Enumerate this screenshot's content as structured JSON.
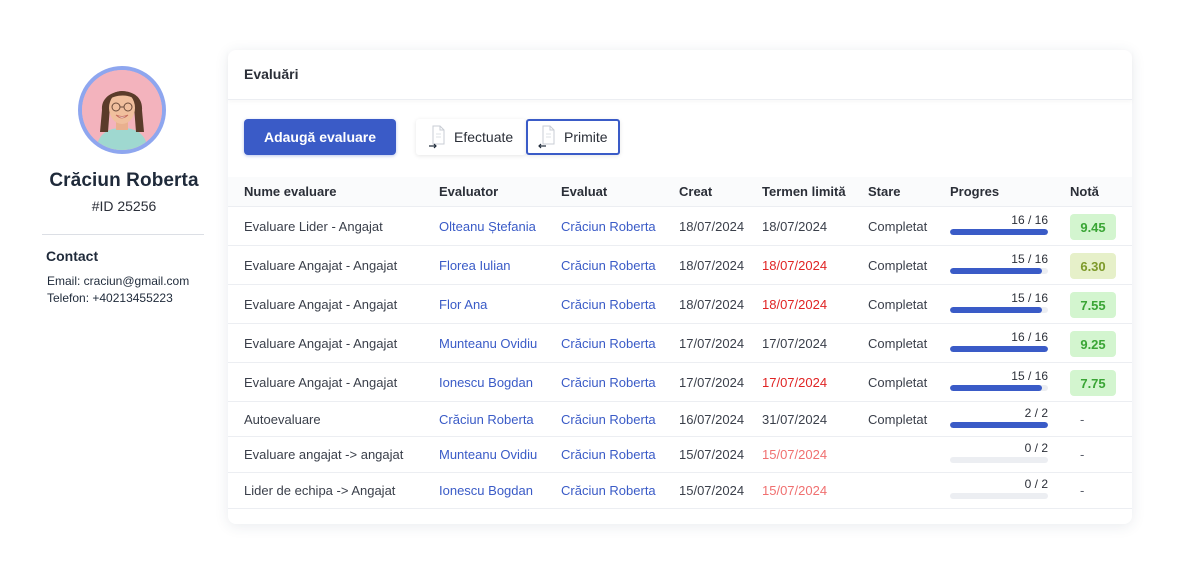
{
  "profile": {
    "name": "Crăciun Roberta",
    "id": "#ID 25256",
    "contact_title": "Contact",
    "email_line": "Email: craciun@gmail.com",
    "phone_line": "Telefon: +40213455223"
  },
  "card": {
    "title": "Evaluări",
    "add_button": "Adaugă evaluare",
    "tab_done": "Efectuate",
    "tab_received": "Primite",
    "active_tab": "Primite"
  },
  "table": {
    "headers": [
      "Nume evaluare",
      "Evaluator",
      "Evaluat",
      "Creat",
      "Termen limită",
      "Stare",
      "Progres",
      "Notă"
    ],
    "rows": [
      {
        "name": "Evaluare Lider - Angajat",
        "evaluator": "Olteanu Ștefania",
        "evaluated": "Crăciun Roberta",
        "created": "18/07/2024",
        "deadline": "18/07/2024",
        "deadline_status": "normal",
        "status": "Completat",
        "progress": "16 / 16",
        "progress_fraction": 1.0,
        "grade": "9.45",
        "grade_style": "green"
      },
      {
        "name": "Evaluare Angajat - Angajat",
        "evaluator": "Florea Iulian",
        "evaluated": "Crăciun Roberta",
        "created": "18/07/2024",
        "deadline": "18/07/2024",
        "deadline_status": "overdue",
        "status": "Completat",
        "progress": "15 / 16",
        "progress_fraction": 0.9375,
        "grade": "6.30",
        "grade_style": "olive"
      },
      {
        "name": "Evaluare Angajat - Angajat",
        "evaluator": "Flor Ana",
        "evaluated": "Crăciun Roberta",
        "created": "18/07/2024",
        "deadline": "18/07/2024",
        "deadline_status": "overdue",
        "status": "Completat",
        "progress": "15 / 16",
        "progress_fraction": 0.9375,
        "grade": "7.55",
        "grade_style": "green"
      },
      {
        "name": "Evaluare Angajat - Angajat",
        "evaluator": "Munteanu Ovidiu",
        "evaluated": "Crăciun Roberta",
        "created": "17/07/2024",
        "deadline": "17/07/2024",
        "deadline_status": "normal",
        "status": "Completat",
        "progress": "16 / 16",
        "progress_fraction": 1.0,
        "grade": "9.25",
        "grade_style": "green"
      },
      {
        "name": "Evaluare Angajat - Angajat",
        "evaluator": "Ionescu Bogdan",
        "evaluated": "Crăciun Roberta",
        "created": "17/07/2024",
        "deadline": "17/07/2024",
        "deadline_status": "overdue",
        "status": "Completat",
        "progress": "15 / 16",
        "progress_fraction": 0.9375,
        "grade": "7.75",
        "grade_style": "green"
      },
      {
        "name": "Autoevaluare",
        "evaluator": "Crăciun Roberta",
        "evaluated": "Crăciun Roberta",
        "created": "16/07/2024",
        "deadline": "31/07/2024",
        "deadline_status": "normal",
        "status": "Completat",
        "progress": "2 / 2",
        "progress_fraction": 1.0,
        "grade": "-",
        "grade_style": "none"
      },
      {
        "name": "Evaluare angajat -> angajat",
        "evaluator": "Munteanu Ovidiu",
        "evaluated": "Crăciun Roberta",
        "created": "15/07/2024",
        "deadline": "15/07/2024",
        "deadline_status": "soon",
        "status": "",
        "progress": "0 / 2",
        "progress_fraction": 0.0,
        "grade": "-",
        "grade_style": "none"
      },
      {
        "name": "Lider de echipa -> Angajat",
        "evaluator": "Ionescu Bogdan",
        "evaluated": "Crăciun Roberta",
        "created": "15/07/2024",
        "deadline": "15/07/2024",
        "deadline_status": "soon",
        "status": "",
        "progress": "0 / 2",
        "progress_fraction": 0.0,
        "grade": "-",
        "grade_style": "none"
      }
    ]
  },
  "colors": {
    "accent": "#3a5bc7",
    "overdue": "#e02424",
    "soon": "#f07070",
    "grade_green_bg": "#d3f5cf",
    "grade_olive_bg": "#e6f0c9"
  },
  "icons": {
    "tab_done": "document-arrow-out-icon",
    "tab_received": "document-arrow-in-icon"
  }
}
